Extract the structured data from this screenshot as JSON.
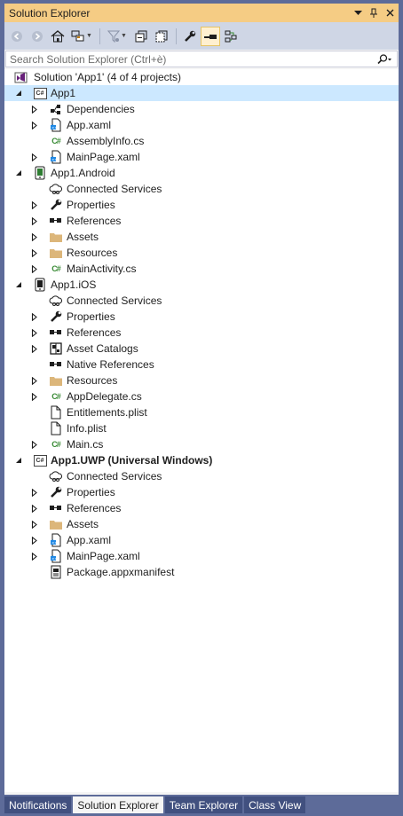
{
  "window": {
    "title": "Solution Explorer",
    "buttons": [
      "dropdown-arrow-icon",
      "pin-icon",
      "close-icon"
    ]
  },
  "toolbar": {
    "buttons": [
      "back-icon",
      "forward-icon",
      "home-icon",
      "switch-views-icon",
      "pending-changes-filter-icon",
      "collapse-all-icon",
      "show-all-files-icon",
      "properties-icon",
      "preview-selected-items-icon",
      "sync-with-active-document-icon"
    ]
  },
  "search": {
    "placeholder": "Search Solution Explorer (Ctrl+è)"
  },
  "tree": {
    "solution": "Solution 'App1' (4 of 4 projects)",
    "items": [
      {
        "label": "App1",
        "level": 1,
        "icon": "csharp-project-icon",
        "expander": "expanded",
        "selected": true
      },
      {
        "label": "Dependencies",
        "level": 2,
        "icon": "dependencies-icon",
        "expander": "collapsed"
      },
      {
        "label": "App.xaml",
        "level": 2,
        "icon": "xaml-file-icon",
        "expander": "collapsed"
      },
      {
        "label": "AssemblyInfo.cs",
        "level": 2,
        "icon": "csharp-file-icon",
        "expander": "none"
      },
      {
        "label": "MainPage.xaml",
        "level": 2,
        "icon": "xaml-file-icon",
        "expander": "collapsed"
      },
      {
        "label": "App1.Android",
        "level": 1,
        "icon": "android-project-icon",
        "expander": "expanded"
      },
      {
        "label": "Connected Services",
        "level": 2,
        "icon": "connected-services-icon",
        "expander": "none"
      },
      {
        "label": "Properties",
        "level": 2,
        "icon": "wrench-icon",
        "expander": "collapsed"
      },
      {
        "label": "References",
        "level": 2,
        "icon": "references-icon",
        "expander": "collapsed"
      },
      {
        "label": "Assets",
        "level": 2,
        "icon": "folder-icon",
        "expander": "collapsed"
      },
      {
        "label": "Resources",
        "level": 2,
        "icon": "folder-icon",
        "expander": "collapsed"
      },
      {
        "label": "MainActivity.cs",
        "level": 2,
        "icon": "csharp-file-icon",
        "expander": "collapsed"
      },
      {
        "label": "App1.iOS",
        "level": 1,
        "icon": "ios-project-icon",
        "expander": "expanded"
      },
      {
        "label": "Connected Services",
        "level": 2,
        "icon": "connected-services-icon",
        "expander": "none"
      },
      {
        "label": "Properties",
        "level": 2,
        "icon": "wrench-icon",
        "expander": "collapsed"
      },
      {
        "label": "References",
        "level": 2,
        "icon": "references-icon",
        "expander": "collapsed"
      },
      {
        "label": "Asset Catalogs",
        "level": 2,
        "icon": "asset-catalog-icon",
        "expander": "collapsed"
      },
      {
        "label": "Native References",
        "level": 2,
        "icon": "references-icon",
        "expander": "none"
      },
      {
        "label": "Resources",
        "level": 2,
        "icon": "folder-icon",
        "expander": "collapsed"
      },
      {
        "label": "AppDelegate.cs",
        "level": 2,
        "icon": "csharp-file-icon",
        "expander": "collapsed"
      },
      {
        "label": "Entitlements.plist",
        "level": 2,
        "icon": "file-icon",
        "expander": "none"
      },
      {
        "label": "Info.plist",
        "level": 2,
        "icon": "file-icon",
        "expander": "none"
      },
      {
        "label": "Main.cs",
        "level": 2,
        "icon": "csharp-file-icon",
        "expander": "collapsed"
      },
      {
        "label": "App1.UWP (Universal Windows)",
        "level": 1,
        "icon": "csharp-project-icon",
        "expander": "expanded",
        "bold": true
      },
      {
        "label": "Connected Services",
        "level": 2,
        "icon": "connected-services-icon",
        "expander": "none"
      },
      {
        "label": "Properties",
        "level": 2,
        "icon": "wrench-icon",
        "expander": "collapsed"
      },
      {
        "label": "References",
        "level": 2,
        "icon": "references-icon",
        "expander": "collapsed"
      },
      {
        "label": "Assets",
        "level": 2,
        "icon": "folder-icon",
        "expander": "collapsed"
      },
      {
        "label": "App.xaml",
        "level": 2,
        "icon": "xaml-file-icon",
        "expander": "collapsed"
      },
      {
        "label": "MainPage.xaml",
        "level": 2,
        "icon": "xaml-file-icon",
        "expander": "collapsed"
      },
      {
        "label": "Package.appxmanifest",
        "level": 2,
        "icon": "manifest-icon",
        "expander": "none"
      }
    ]
  },
  "bottom_tabs": [
    {
      "label": "Notifications",
      "active": false
    },
    {
      "label": "Solution Explorer",
      "active": true
    },
    {
      "label": "Team Explorer",
      "active": false
    },
    {
      "label": "Class View",
      "active": false
    }
  ],
  "colors": {
    "title_bar": "#f5cc84",
    "toolbar": "#cfd6e5",
    "frame": "#5d6b99",
    "selection": "#cce8ff",
    "tab_inactive": "#41507f"
  }
}
